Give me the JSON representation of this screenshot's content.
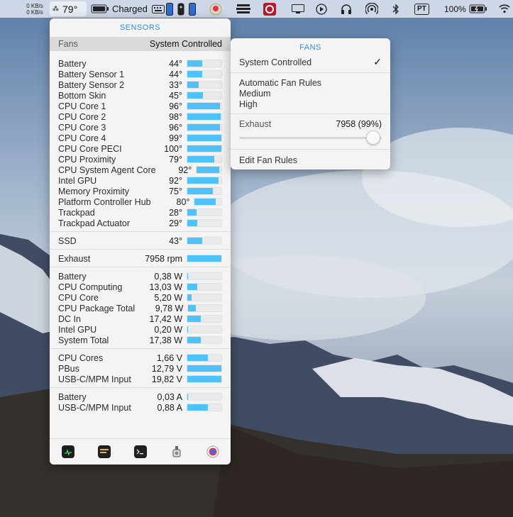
{
  "menubar": {
    "net_up": "0 KB/s",
    "net_down": "0 KB/s",
    "temp": "79°",
    "battery_status": "Charged",
    "input_lang": "PT",
    "battery_pct": "100%"
  },
  "sensors": {
    "title": "SENSORS",
    "fans_label": "Fans",
    "fans_mode": "System Controlled",
    "temperatures": [
      {
        "label": "Battery",
        "value": "44°",
        "level": 0.44
      },
      {
        "label": "Battery Sensor 1",
        "value": "44°",
        "level": 0.44
      },
      {
        "label": "Battery Sensor 2",
        "value": "33°",
        "level": 0.33
      },
      {
        "label": "Bottom Skin",
        "value": "45°",
        "level": 0.45
      },
      {
        "label": "CPU Core 1",
        "value": "96°",
        "level": 0.96
      },
      {
        "label": "CPU Core 2",
        "value": "98°",
        "level": 0.98
      },
      {
        "label": "CPU Core 3",
        "value": "96°",
        "level": 0.96
      },
      {
        "label": "CPU Core 4",
        "value": "99°",
        "level": 0.99
      },
      {
        "label": "CPU Core PECI",
        "value": "100°",
        "level": 1.0
      },
      {
        "label": "CPU Proximity",
        "value": "79°",
        "level": 0.79
      },
      {
        "label": "CPU System Agent Core",
        "value": "92°",
        "level": 0.92
      },
      {
        "label": "Intel GPU",
        "value": "92°",
        "level": 0.92
      },
      {
        "label": "Memory Proximity",
        "value": "75°",
        "level": 0.75
      },
      {
        "label": "Platform Controller Hub",
        "value": "80°",
        "level": 0.8
      },
      {
        "label": "Trackpad",
        "value": "28°",
        "level": 0.28
      },
      {
        "label": "Trackpad Actuator",
        "value": "29°",
        "level": 0.29
      }
    ],
    "ssd": [
      {
        "label": "SSD",
        "value": "43°",
        "level": 0.43
      }
    ],
    "fans": [
      {
        "label": "Exhaust",
        "value": "7958 rpm",
        "level": 0.99
      }
    ],
    "power": [
      {
        "label": "Battery",
        "value": "0,38 W",
        "level": 0.01
      },
      {
        "label": "CPU Computing",
        "value": "13,03 W",
        "level": 0.3
      },
      {
        "label": "CPU Core",
        "value": "5,20 W",
        "level": 0.12
      },
      {
        "label": "CPU Package Total",
        "value": "9,78 W",
        "level": 0.22
      },
      {
        "label": "DC In",
        "value": "17,42 W",
        "level": 0.4
      },
      {
        "label": "Intel GPU",
        "value": "0,20 W",
        "level": 0.01
      },
      {
        "label": "System Total",
        "value": "17,38 W",
        "level": 0.4
      }
    ],
    "voltage": [
      {
        "label": "CPU Cores",
        "value": "1,66 V",
        "level": 0.6
      },
      {
        "label": "PBus",
        "value": "12,79 V",
        "level": 1.0
      },
      {
        "label": "USB-C/MPM Input",
        "value": "19,82 V",
        "level": 1.0
      }
    ],
    "current": [
      {
        "label": "Battery",
        "value": "0,03 A",
        "level": 0.01
      },
      {
        "label": "USB-C/MPM Input",
        "value": "0,88 A",
        "level": 0.6
      }
    ],
    "toolbar": [
      "activity-monitor-icon",
      "console-icon",
      "terminal-icon",
      "app-icon",
      "preferences-icon"
    ]
  },
  "fans_menu": {
    "title": "FANS",
    "system_controlled": "System Controlled",
    "checkmark": "✓",
    "rules": [
      "Automatic Fan Rules",
      "Medium",
      "High"
    ],
    "exhaust_label": "Exhaust",
    "exhaust_value": "7958 (99%)",
    "exhaust_level": 0.99,
    "edit_rules": "Edit Fan Rules"
  },
  "colors": {
    "accent": "#2a8ee0",
    "bar_fill": "#4fc3f7"
  }
}
